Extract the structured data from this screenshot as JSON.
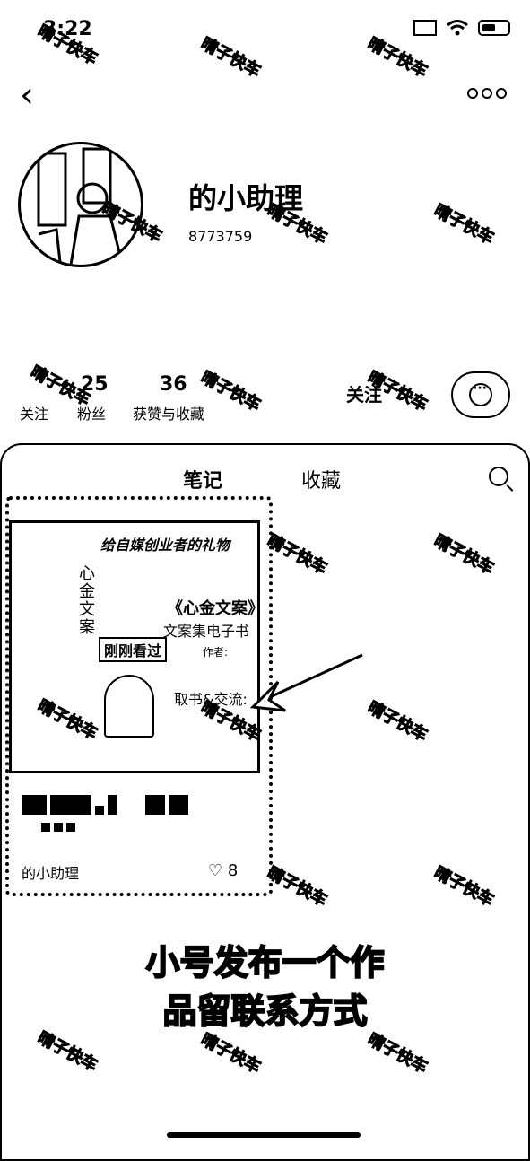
{
  "status_bar": {
    "time": "3:22"
  },
  "nav": {
    "back_icon": "chevron-left-icon",
    "more_icon": "more-horizontal-icon"
  },
  "profile": {
    "name": "的小助理",
    "id_text": "8773759",
    "stats": [
      {
        "value": "25",
        "label": "关注"
      },
      {
        "value": "36",
        "label": "获赞与收藏"
      }
    ],
    "fans_label": "粉丝",
    "follow_label": "关注"
  },
  "tabs": [
    {
      "label": "笔记"
    },
    {
      "label": "收藏"
    }
  ],
  "note": {
    "cover_title": "给自媒创业者的礼物",
    "book_title": "《心金文案》",
    "book_subtitle": "文案集电子书",
    "author_label": "作者:",
    "contact_label": "取书&交流:",
    "recent_badge": "刚刚看过",
    "vertical_title": "心金文案",
    "author_name": "的小助理",
    "likes": "8"
  },
  "caption": {
    "line1": "小号发布一个作",
    "line2": "品留联系方式"
  },
  "watermark": "晴子快车"
}
